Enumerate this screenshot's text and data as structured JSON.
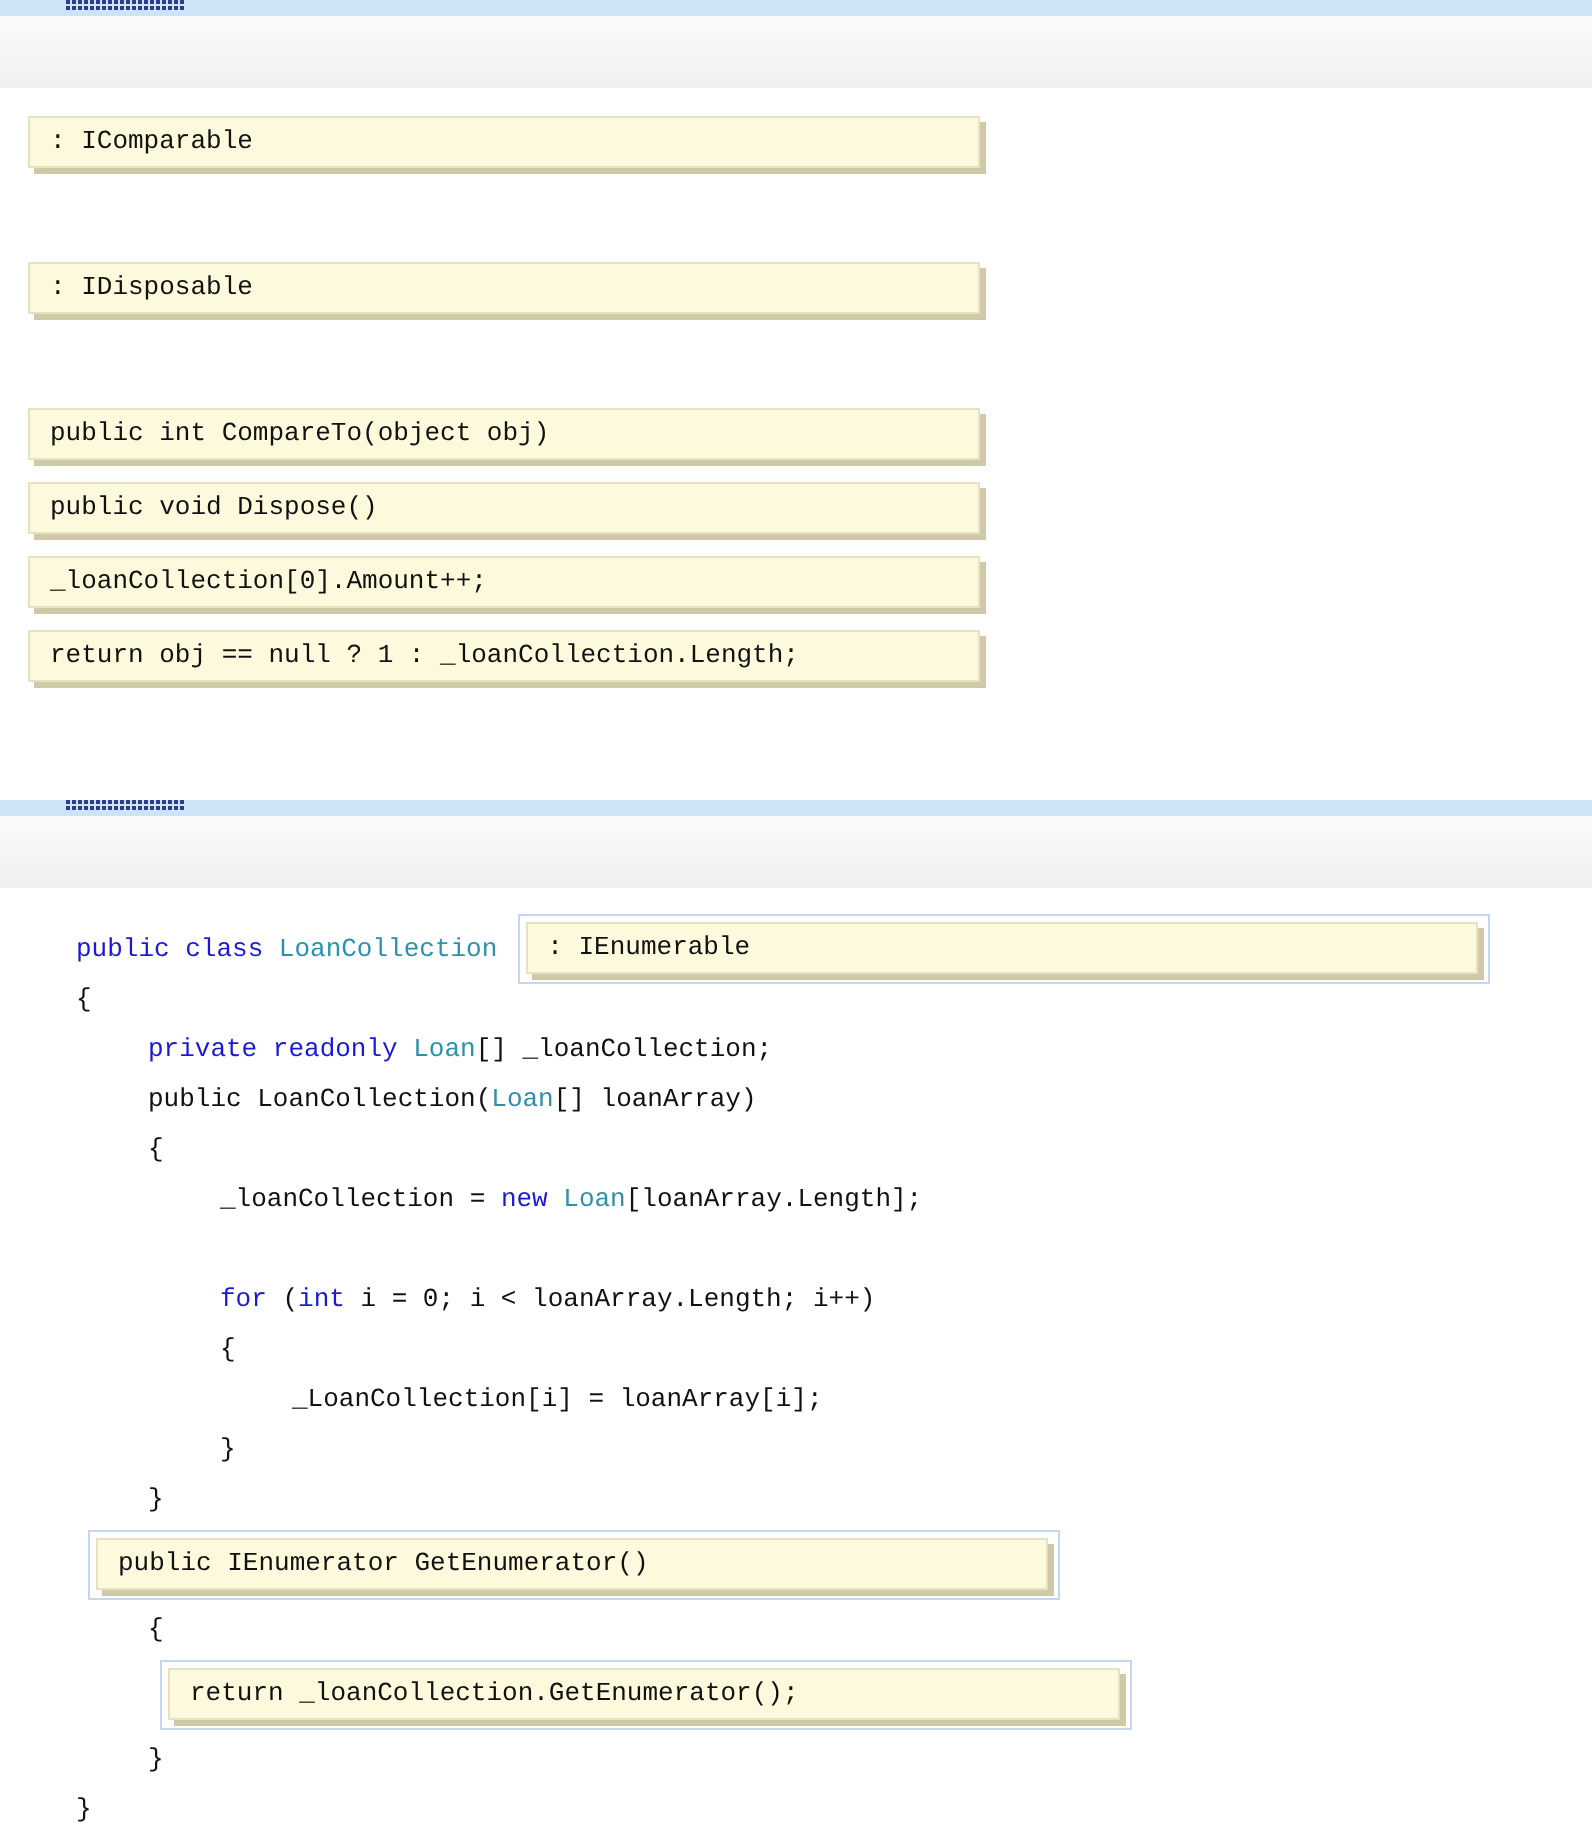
{
  "answer_tiles": {
    "groups": [
      {
        "tiles": [
          {
            "text": ": IComparable"
          }
        ]
      },
      {
        "tiles": [
          {
            "text": ": IDisposable"
          }
        ]
      },
      {
        "tiles": [
          {
            "text": "public int CompareTo(object obj)"
          },
          {
            "text": "public void Dispose()"
          },
          {
            "text": "_loanCollection[0].Amount++;"
          },
          {
            "text": "return obj == null ? 1 : _loanCollection.Length;"
          }
        ]
      }
    ]
  },
  "code": {
    "lines": [
      {
        "kind": "code",
        "segments": [
          {
            "text": "public class",
            "kind": "keyword"
          },
          {
            "text": " LoanCollection",
            "kind": "type"
          }
        ],
        "zone": {
          "text": ": IEnumerable"
        }
      },
      {
        "kind": "code",
        "segments": [
          {
            "text": "{",
            "kind": "plain"
          }
        ],
        "children": [
          {
            "kind": "code",
            "segments": [
              {
                "text": "private readonly ",
                "kind": "keyword"
              },
              {
                "text": "Loan",
                "kind": "type"
              },
              {
                "text": "[] _loanCollection;",
                "kind": "plain"
              }
            ]
          },
          {
            "kind": "code",
            "segments": [
              {
                "text": "public LoanCollection(",
                "kind": "plain"
              },
              {
                "text": "Loan",
                "kind": "type"
              },
              {
                "text": "[] loanArray)",
                "kind": "plain"
              }
            ]
          },
          {
            "kind": "code",
            "segments": [
              {
                "text": "{",
                "kind": "plain"
              }
            ],
            "children": [
              {
                "kind": "code",
                "segments": [
                  {
                    "text": "_loanCollection = ",
                    "kind": "plain"
                  },
                  {
                    "text": "new ",
                    "kind": "keyword"
                  },
                  {
                    "text": "Loan",
                    "kind": "type"
                  },
                  {
                    "text": "[loanArray.Length];",
                    "kind": "plain"
                  }
                ]
              },
              {
                "kind": "blank"
              },
              {
                "kind": "code",
                "segments": [
                  {
                    "text": "for",
                    "kind": "keyword"
                  },
                  {
                    "text": " (",
                    "kind": "plain"
                  },
                  {
                    "text": "int",
                    "kind": "keyword"
                  },
                  {
                    "text": " i = 0; i < loanArray.Length; i++)",
                    "kind": "plain"
                  }
                ]
              },
              {
                "kind": "code",
                "segments": [
                  {
                    "text": "{",
                    "kind": "plain"
                  }
                ],
                "children": [
                  {
                    "kind": "code",
                    "segments": [
                      {
                        "text": "_LoanCollection[i] = loanArray[i];",
                        "kind": "plain"
                      }
                    ]
                  }
                ]
              },
              {
                "kind": "code",
                "segments": [
                  {
                    "text": "}",
                    "kind": "plain"
                  }
                ]
              }
            ]
          },
          {
            "kind": "code",
            "segments": [
              {
                "text": "}",
                "kind": "plain"
              }
            ]
          },
          {
            "kind": "zone",
            "zone": {
              "text": "public IEnumerator GetEnumerator()"
            }
          },
          {
            "kind": "code",
            "segments": [
              {
                "text": "{",
                "kind": "plain"
              }
            ],
            "children": [
              {
                "kind": "zone",
                "zone": {
                  "text": "return _loanCollection.GetEnumerator();"
                }
              }
            ]
          },
          {
            "kind": "code",
            "segments": [
              {
                "text": "}",
                "kind": "plain"
              }
            ]
          }
        ]
      },
      {
        "kind": "code",
        "segments": [
          {
            "text": "}",
            "kind": "plain"
          }
        ]
      }
    ]
  }
}
